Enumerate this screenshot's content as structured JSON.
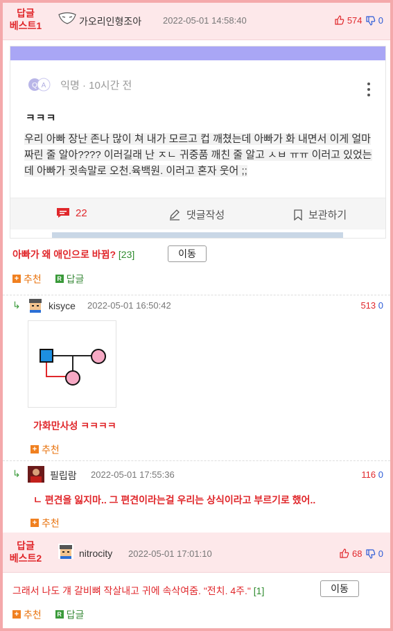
{
  "best1": {
    "badge_line1": "답글",
    "badge_line2": "베스트1",
    "nickname": "가오리인형조아",
    "datetime": "2022-05-01 14:58:40",
    "up_count": "574",
    "down_count": "0"
  },
  "embedded_post": {
    "meta": "익명 · 10시간 전",
    "title": "ㅋㅋㅋ",
    "body": "우리 아빠 장난 존나 많이 쳐 내가 모르고 컵 깨쳤는데 아빠가 화 내면서 이게 얼마 짜린 줄 알아???? 이러길래 난 ㅈㄴ 귀중품 깨친 줄 알고 ㅅㅂ ㅠㅠ 이러고 있었는데 아빠가 귓속말로 오천.육백원. 이러고 혼자 웃어 ;;",
    "comment_count": "22",
    "write_comment": "댓글작성",
    "save_label": "보관하기"
  },
  "post_line": {
    "title": "아빠가 왜 애인으로 바뀜?",
    "count": "[23]",
    "move_label": "이동"
  },
  "actions": {
    "recommend": "추천",
    "reply": "답글",
    "plus_glyph": "+",
    "r_glyph": "R"
  },
  "reply1": {
    "arrow": "↳",
    "nickname": "kisyce",
    "datetime": "2022-05-01 16:50:42",
    "up_count": "513",
    "down_count": "0",
    "text": "가화만사성 ㅋㅋㅋㅋ"
  },
  "reply2": {
    "arrow": "↳",
    "nickname": "필립람",
    "datetime": "2022-05-01 17:55:36",
    "up_count": "116",
    "down_count": "0",
    "text": "ㄴ 편견을 잃지마.. 그 편견이라는걸 우리는 상식이라고 부르기로 했어.."
  },
  "best2": {
    "badge_line1": "답글",
    "badge_line2": "베스트2",
    "nickname": "nitrocity",
    "datetime": "2022-05-01 17:01:10",
    "up_count": "68",
    "down_count": "0",
    "text": "그래서 나도 걔 갈비뼈 작살내고 귀에 속삭여줌. \"전치. 4주.\"",
    "count": "[1]",
    "move_label": "이동"
  },
  "colors": {
    "accent_red": "#e0272b",
    "down_blue": "#2a5ad6",
    "header_pink": "#fde8ea",
    "border_pink": "#f4a9ab",
    "reply_green": "#3a9a3a"
  },
  "icons": [
    "mask-avatar-icon",
    "thumbs-up-icon",
    "thumbs-down-icon",
    "qa-bubble-icon",
    "kebab-menu-icon",
    "comment-icon",
    "pencil-icon",
    "bookmark-icon",
    "reply-arrow-icon",
    "plus-icon",
    "reply-r-icon",
    "pixel-avatar-icon",
    "photo-avatar-icon"
  ]
}
